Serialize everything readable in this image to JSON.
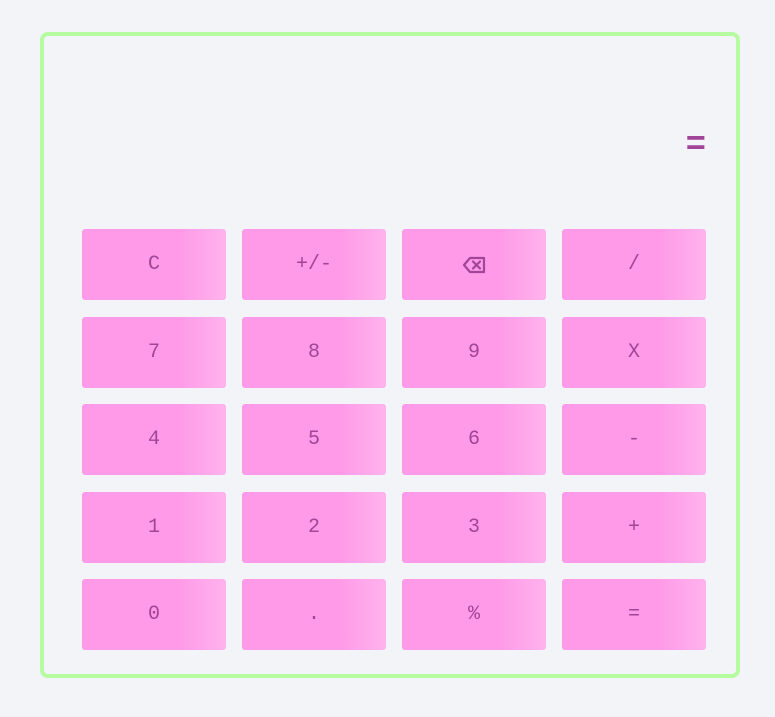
{
  "colors": {
    "background": "#f3f4f8",
    "border": "#b6fba0",
    "key_fill": "#ff9ae8",
    "text": "#a04598"
  },
  "display": {
    "value": "="
  },
  "keys": [
    {
      "label": "C",
      "name": "clear-button"
    },
    {
      "label": "+/-",
      "name": "toggle-sign-button"
    },
    {
      "label": "",
      "icon": "backspace-icon",
      "name": "backspace-button"
    },
    {
      "label": "/",
      "name": "divide-button"
    },
    {
      "label": "7",
      "name": "digit-7-button"
    },
    {
      "label": "8",
      "name": "digit-8-button"
    },
    {
      "label": "9",
      "name": "digit-9-button"
    },
    {
      "label": "X",
      "name": "multiply-button"
    },
    {
      "label": "4",
      "name": "digit-4-button"
    },
    {
      "label": "5",
      "name": "digit-5-button"
    },
    {
      "label": "6",
      "name": "digit-6-button"
    },
    {
      "label": "-",
      "name": "subtract-button"
    },
    {
      "label": "1",
      "name": "digit-1-button"
    },
    {
      "label": "2",
      "name": "digit-2-button"
    },
    {
      "label": "3",
      "name": "digit-3-button"
    },
    {
      "label": "+",
      "name": "add-button"
    },
    {
      "label": "0",
      "name": "digit-0-button"
    },
    {
      "label": ".",
      "name": "decimal-button"
    },
    {
      "label": "%",
      "name": "percent-button"
    },
    {
      "label": "=",
      "name": "equals-button"
    }
  ]
}
